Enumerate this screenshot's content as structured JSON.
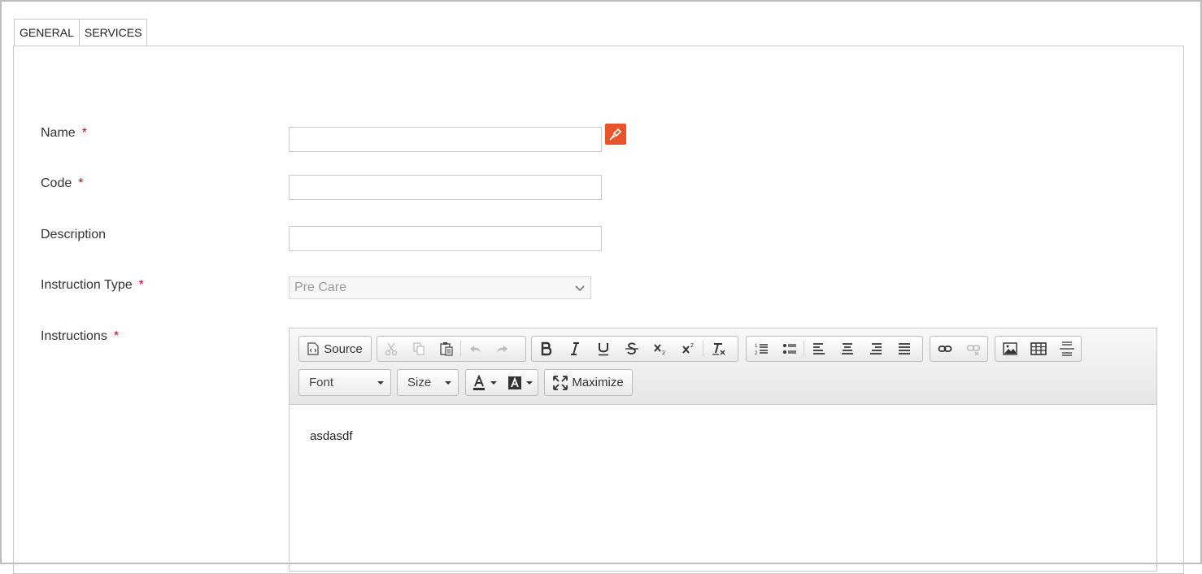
{
  "tabs": [
    {
      "label": "GENERAL"
    },
    {
      "label": "SERVICES"
    }
  ],
  "form": {
    "name": {
      "label": "Name",
      "required_mark": "*",
      "value": ""
    },
    "code": {
      "label": "Code",
      "required_mark": "*",
      "value": ""
    },
    "description": {
      "label": "Description",
      "value": ""
    },
    "instruction_type": {
      "label": "Instruction Type",
      "required_mark": "*",
      "selected": "Pre Care"
    },
    "instructions": {
      "label": "Instructions",
      "required_mark": "*"
    }
  },
  "editor": {
    "source_label": "Source",
    "font_label": "Font",
    "size_label": "Size",
    "maximize_label": "Maximize",
    "content": "asdasdf"
  },
  "colors": {
    "accent": "#e8542a",
    "required": "#d9001b"
  }
}
